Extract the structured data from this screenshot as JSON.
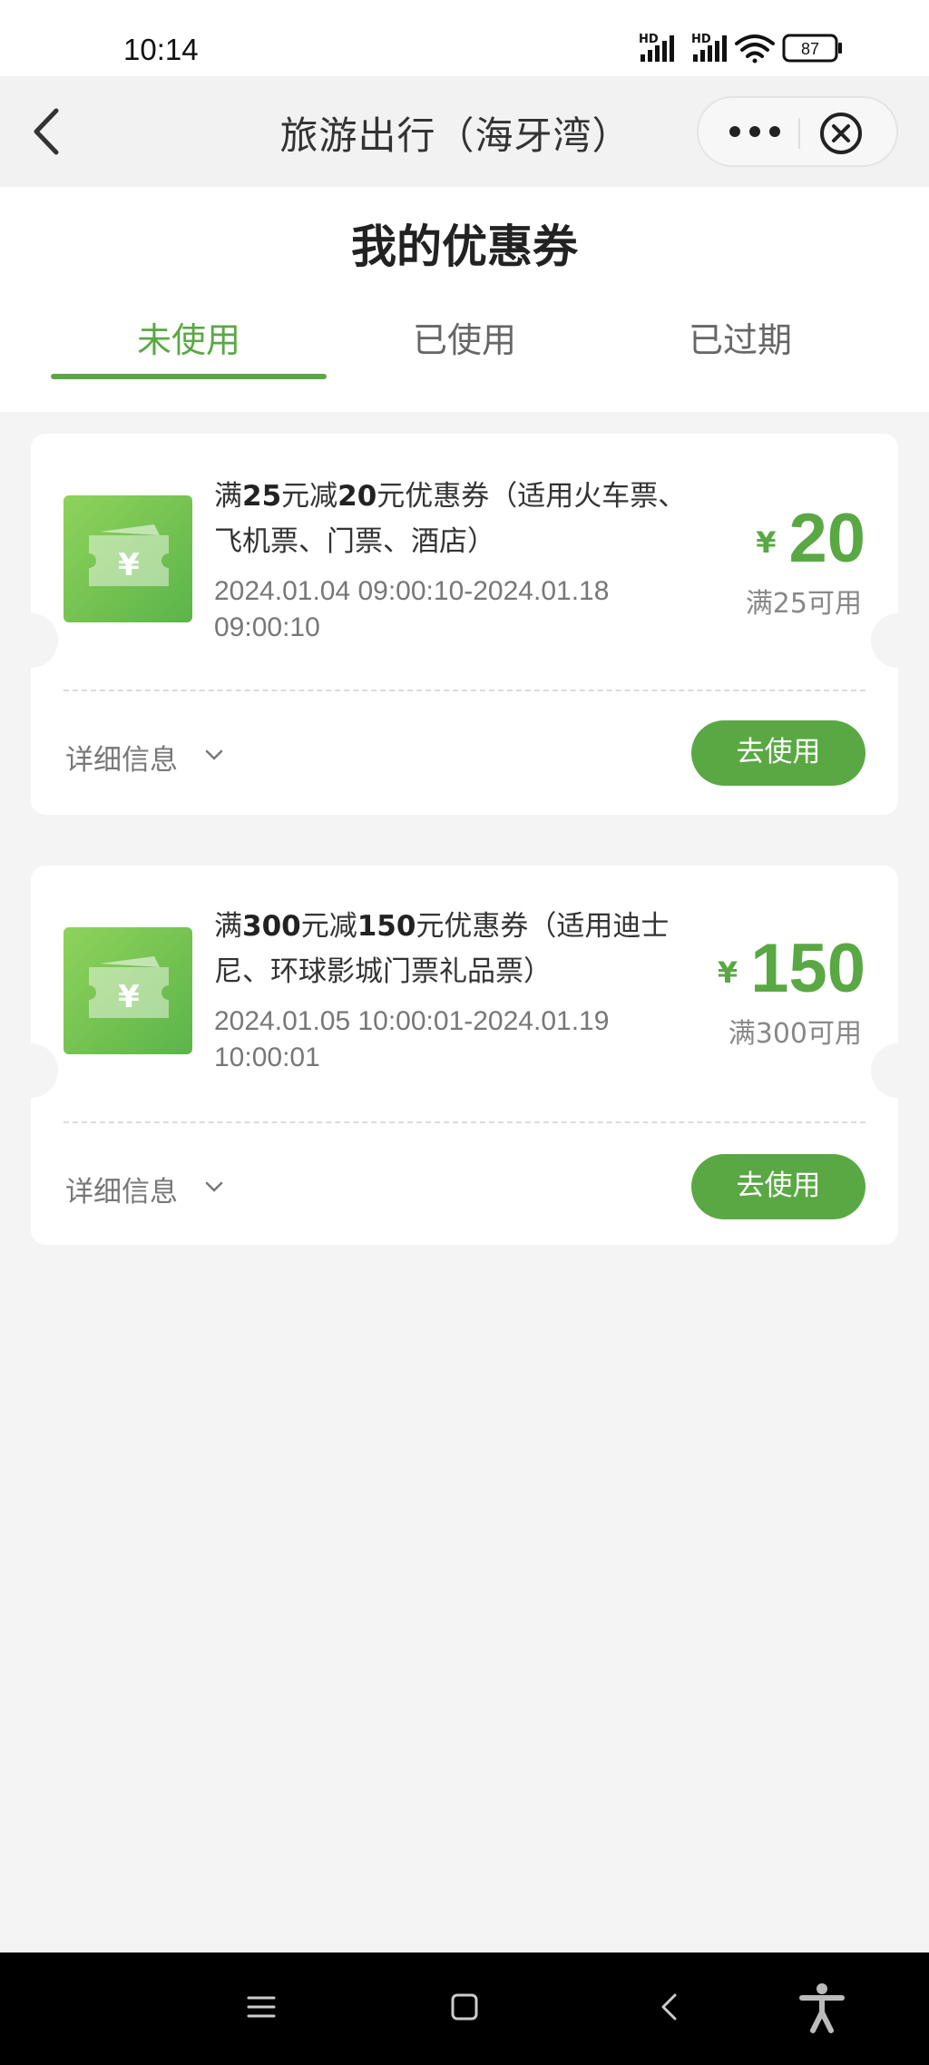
{
  "status_bar": {
    "time": "10:14",
    "battery": "87",
    "signal_label_1": "HD",
    "signal_label_2": "HD"
  },
  "nav": {
    "title": "旅游出行（海牙湾）",
    "back_icon": "chevron-left-icon",
    "more_icon": "more-dots-icon",
    "close_icon": "circle-close-icon"
  },
  "page": {
    "title": "我的优惠券",
    "tabs": [
      {
        "label": "未使用",
        "active": true
      },
      {
        "label": "已使用",
        "active": false
      },
      {
        "label": "已过期",
        "active": false
      }
    ]
  },
  "coupons": [
    {
      "prefix": "满",
      "threshold": "25",
      "mid": "元减",
      "discount": "20",
      "suffix": "元优惠券（适用火车票、飞机票、门票、酒店）",
      "date_line1": "2024.01.04 09:00:10-2024.01.18",
      "date_line2": "09:00:10",
      "currency": "¥",
      "amount": "20",
      "condition": "满25可用",
      "detail_label": "详细信息",
      "use_label": "去使用"
    },
    {
      "prefix": "满",
      "threshold": "300",
      "mid": "元减",
      "discount": "150",
      "suffix": "元优惠券（适用迪士尼、环球影城门票礼品票）",
      "date_line1": "2024.01.05 10:00:01-2024.01.19",
      "date_line2": "10:00:01",
      "currency": "¥",
      "amount": "150",
      "condition": "满300可用",
      "detail_label": "详细信息",
      "use_label": "去使用"
    }
  ],
  "system_nav": {
    "menu_icon": "menu-icon",
    "home_icon": "home-square-icon",
    "back_icon": "back-triangle-icon",
    "accessibility_icon": "accessibility-icon"
  },
  "colors": {
    "accent": "#5aa844",
    "background": "#f4f4f4"
  }
}
